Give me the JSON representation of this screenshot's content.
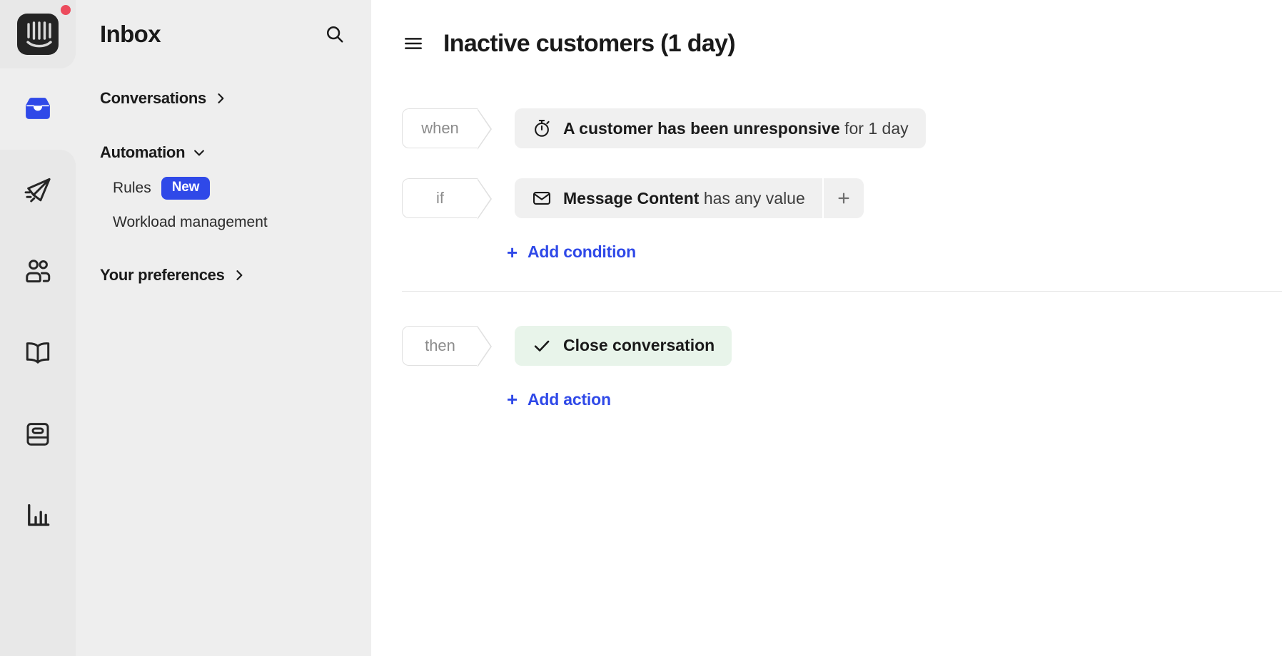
{
  "app": {
    "logo_name": "intercom-logo",
    "notification_dot": true,
    "accent_color": "#2f49e8",
    "action_pill_color": "#e8f4ea",
    "badge_color": "#2f49e8",
    "dot_color": "#ec4b5c"
  },
  "rail": {
    "items": [
      {
        "icon": "inbox-icon",
        "name": "inbox",
        "active": true
      },
      {
        "icon": "paper-plane-icon",
        "name": "outbound",
        "active": false
      },
      {
        "icon": "contacts-icon",
        "name": "contacts",
        "active": false
      },
      {
        "icon": "book-icon",
        "name": "knowledge-base",
        "active": false
      },
      {
        "icon": "news-card-icon",
        "name": "news",
        "active": false
      },
      {
        "icon": "bar-chart-icon",
        "name": "reports",
        "active": false
      }
    ]
  },
  "sidebar": {
    "title": "Inbox",
    "search_icon": "search-icon",
    "groups": [
      {
        "label": "Conversations",
        "chevron": "chevron-right-icon",
        "expanded": false,
        "items": []
      },
      {
        "label": "Automation",
        "chevron": "chevron-down-icon",
        "expanded": true,
        "items": [
          {
            "label": "Rules",
            "badge": "New"
          },
          {
            "label": "Workload management",
            "badge": null
          }
        ]
      },
      {
        "label": "Your preferences",
        "chevron": "chevron-right-icon",
        "expanded": false,
        "items": []
      }
    ]
  },
  "main": {
    "menu_icon": "hamburger-menu-icon",
    "title": "Inactive customers (1 day)",
    "trigger": {
      "tag": "when",
      "icon": "stopwatch-icon",
      "text_bold": "A customer has been unresponsive",
      "text_light": " for 1 day"
    },
    "condition": {
      "tag": "if",
      "icon": "envelope-icon",
      "text_bold": "Message Content",
      "text_light": " has any value",
      "add_icon": "plus-icon"
    },
    "add_condition": {
      "plus": "+",
      "label": "Add condition"
    },
    "action": {
      "tag": "then",
      "icon": "checkmark-icon",
      "label": "Close conversation"
    },
    "add_action": {
      "plus": "+",
      "label": "Add action"
    }
  }
}
